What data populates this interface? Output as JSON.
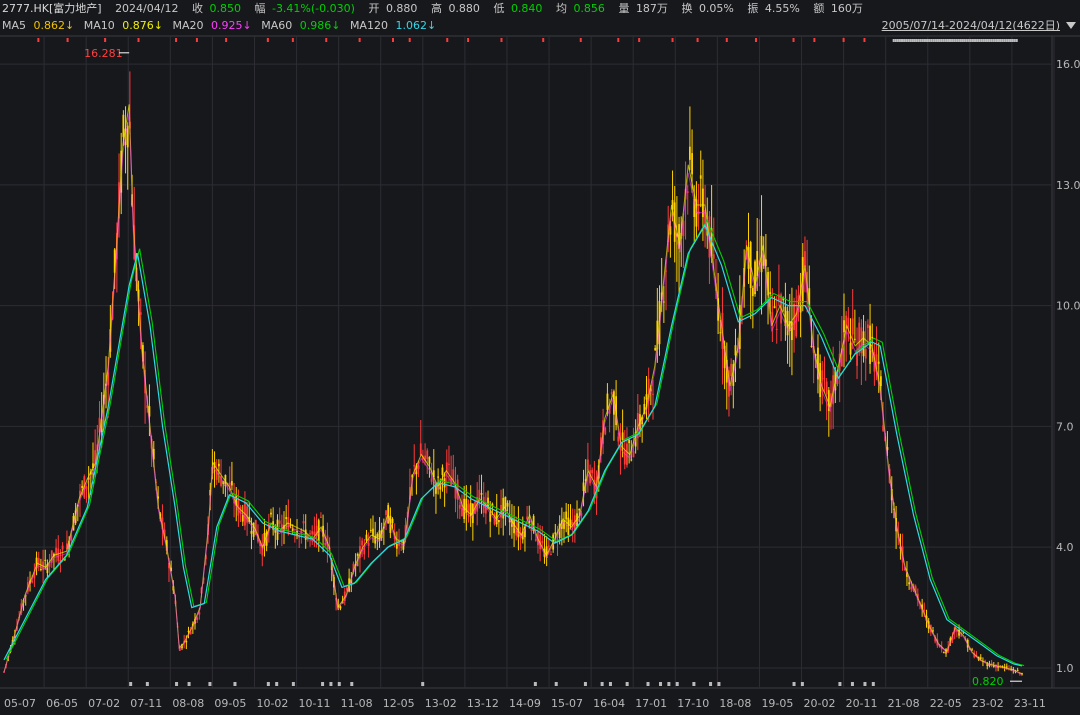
{
  "header": {
    "ticker": "2777.HK[富力地产]",
    "date": "2024/04/12",
    "close_label": "收",
    "close": "0.850",
    "change_label": "幅",
    "change": "-3.41%(-0.030)",
    "open_label": "开",
    "open": "0.880",
    "high_label": "高",
    "high": "0.880",
    "low_label": "低",
    "low": "0.840",
    "avg_label": "均",
    "avg": "0.856",
    "volume_label": "量",
    "volume": "187万",
    "turnover_label": "换",
    "turnover": "0.05%",
    "amplitude_label": "振",
    "amplitude": "4.55%",
    "amount_label": "额",
    "amount": "160万"
  },
  "ma_legend": [
    {
      "label": "MA5",
      "value": "0.862↓",
      "color": "#f0c000"
    },
    {
      "label": "MA10",
      "value": "0.876↓",
      "color": "#f0f000"
    },
    {
      "label": "MA20",
      "value": "0.925↓",
      "color": "#ff3cff"
    },
    {
      "label": "MA60",
      "value": "0.986↓",
      "color": "#00d000"
    },
    {
      "label": "MA120",
      "value": "1.062↓",
      "color": "#30d8e8"
    }
  ],
  "range_label": "2005/07/14-2024/04/12(4622日)",
  "colors": {
    "up": "#ff3a3a",
    "down": "#00e0e0",
    "grid": "#2c2d33",
    "axis": "#b8b8b8"
  },
  "chart_data": {
    "type": "line",
    "ylim": [
      0.8,
      16.5
    ],
    "y_ticks": [
      {
        "value": 16.0,
        "label": "16.0"
      },
      {
        "value": 13.0,
        "label": "13.0"
      },
      {
        "value": 10.0,
        "label": "10.0"
      },
      {
        "value": 7.0,
        "label": "7.0"
      },
      {
        "value": 4.0,
        "label": "4.0"
      },
      {
        "value": 1.0,
        "label": "1.0"
      }
    ],
    "x_ticks": [
      "05-07",
      "06-05",
      "07-02",
      "07-11",
      "08-08",
      "09-05",
      "10-02",
      "10-11",
      "11-08",
      "12-05",
      "13-02",
      "13-12",
      "14-09",
      "15-07",
      "16-04",
      "17-01",
      "17-10",
      "18-08",
      "19-05",
      "20-02",
      "20-11",
      "21-08",
      "22-05",
      "23-02",
      "23-11"
    ],
    "x_tick_index": [
      0,
      1,
      2,
      3,
      4,
      5,
      6,
      7,
      8,
      9,
      10,
      11,
      12,
      13,
      14,
      15,
      16,
      17,
      18,
      19,
      20,
      21,
      22,
      23,
      24
    ],
    "price": [
      [
        0,
        0.9
      ],
      [
        0.3,
        2.0
      ],
      [
        0.5,
        2.8
      ],
      [
        0.8,
        3.6
      ],
      [
        1.0,
        3.5
      ],
      [
        1.2,
        3.8
      ],
      [
        1.5,
        3.9
      ],
      [
        1.8,
        5.2
      ],
      [
        2.0,
        5.7
      ],
      [
        2.2,
        6.1
      ],
      [
        2.5,
        8.5
      ],
      [
        2.7,
        11.5
      ],
      [
        2.85,
        14.0
      ],
      [
        3.0,
        15.0
      ],
      [
        3.1,
        12.0
      ],
      [
        3.3,
        9.0
      ],
      [
        3.5,
        7.0
      ],
      [
        3.7,
        5.0
      ],
      [
        3.9,
        4.0
      ],
      [
        4.1,
        2.8
      ],
      [
        4.2,
        1.5
      ],
      [
        4.3,
        1.6
      ],
      [
        4.5,
        2.0
      ],
      [
        4.7,
        2.5
      ],
      [
        4.9,
        4.5
      ],
      [
        5.0,
        6.1
      ],
      [
        5.2,
        5.8
      ],
      [
        5.4,
        5.5
      ],
      [
        5.6,
        5.0
      ],
      [
        5.8,
        4.8
      ],
      [
        6.0,
        4.5
      ],
      [
        6.2,
        4.0
      ],
      [
        6.4,
        4.6
      ],
      [
        6.6,
        4.4
      ],
      [
        6.8,
        4.6
      ],
      [
        7.0,
        4.5
      ],
      [
        7.2,
        4.4
      ],
      [
        7.4,
        4.2
      ],
      [
        7.6,
        4.5
      ],
      [
        7.8,
        4.0
      ],
      [
        8.0,
        2.5
      ],
      [
        8.2,
        2.8
      ],
      [
        8.4,
        3.5
      ],
      [
        8.6,
        4.0
      ],
      [
        8.8,
        4.3
      ],
      [
        9.0,
        4.2
      ],
      [
        9.2,
        4.8
      ],
      [
        9.4,
        4.2
      ],
      [
        9.6,
        4.1
      ],
      [
        9.8,
        5.8
      ],
      [
        10.0,
        6.3
      ],
      [
        10.2,
        6.0
      ],
      [
        10.4,
        5.5
      ],
      [
        10.6,
        5.9
      ],
      [
        10.8,
        5.6
      ],
      [
        11.0,
        5.0
      ],
      [
        11.2,
        4.8
      ],
      [
        11.4,
        5.2
      ],
      [
        11.6,
        5.0
      ],
      [
        11.8,
        4.7
      ],
      [
        12.0,
        5.0
      ],
      [
        12.2,
        4.6
      ],
      [
        12.4,
        4.3
      ],
      [
        12.6,
        4.8
      ],
      [
        12.8,
        4.2
      ],
      [
        13.0,
        3.8
      ],
      [
        13.2,
        4.2
      ],
      [
        13.4,
        4.7
      ],
      [
        13.6,
        4.5
      ],
      [
        13.8,
        4.8
      ],
      [
        14.0,
        5.9
      ],
      [
        14.2,
        5.5
      ],
      [
        14.4,
        7.2
      ],
      [
        14.6,
        7.8
      ],
      [
        14.8,
        6.5
      ],
      [
        15.0,
        6.3
      ],
      [
        15.2,
        7.0
      ],
      [
        15.4,
        7.5
      ],
      [
        15.6,
        8.5
      ],
      [
        15.8,
        10.5
      ],
      [
        16.0,
        12.5
      ],
      [
        16.2,
        11.5
      ],
      [
        16.4,
        13.5
      ],
      [
        16.6,
        12.5
      ],
      [
        16.8,
        12.5
      ],
      [
        17.0,
        11.0
      ],
      [
        17.2,
        9.5
      ],
      [
        17.4,
        8.0
      ],
      [
        17.6,
        9.0
      ],
      [
        17.8,
        11.5
      ],
      [
        18.0,
        10.5
      ],
      [
        18.2,
        11.5
      ],
      [
        18.4,
        9.5
      ],
      [
        18.6,
        10.0
      ],
      [
        18.8,
        9.5
      ],
      [
        19.0,
        9.8
      ],
      [
        19.2,
        11.0
      ],
      [
        19.4,
        9.0
      ],
      [
        19.6,
        8.0
      ],
      [
        19.8,
        7.5
      ],
      [
        20.0,
        8.5
      ],
      [
        20.2,
        9.5
      ],
      [
        20.4,
        9.0
      ],
      [
        20.6,
        9.2
      ],
      [
        20.8,
        9.0
      ],
      [
        21.0,
        8.0
      ],
      [
        21.2,
        6.0
      ],
      [
        21.4,
        4.5
      ],
      [
        21.6,
        3.5
      ],
      [
        21.8,
        3.0
      ],
      [
        22.0,
        2.5
      ],
      [
        22.2,
        2.0
      ],
      [
        22.4,
        1.6
      ],
      [
        22.6,
        1.4
      ],
      [
        22.8,
        2.0
      ],
      [
        23.0,
        1.8
      ],
      [
        23.2,
        1.4
      ],
      [
        23.4,
        1.2
      ],
      [
        23.6,
        1.1
      ],
      [
        23.8,
        1.05
      ],
      [
        24.0,
        1.0
      ],
      [
        24.2,
        0.95
      ],
      [
        24.4,
        0.85
      ]
    ],
    "ma_long": [
      [
        0,
        1.2
      ],
      [
        0.5,
        2.2
      ],
      [
        1.0,
        3.2
      ],
      [
        1.5,
        3.8
      ],
      [
        2.0,
        5.0
      ],
      [
        2.5,
        7.5
      ],
      [
        3.0,
        10.5
      ],
      [
        3.2,
        11.3
      ],
      [
        3.5,
        9.5
      ],
      [
        3.8,
        7.0
      ],
      [
        4.1,
        5.0
      ],
      [
        4.3,
        3.5
      ],
      [
        4.5,
        2.5
      ],
      [
        4.8,
        2.6
      ],
      [
        5.1,
        4.5
      ],
      [
        5.4,
        5.3
      ],
      [
        5.8,
        5.1
      ],
      [
        6.2,
        4.6
      ],
      [
        6.6,
        4.4
      ],
      [
        7.0,
        4.3
      ],
      [
        7.4,
        4.2
      ],
      [
        7.8,
        3.8
      ],
      [
        8.1,
        3.0
      ],
      [
        8.4,
        3.1
      ],
      [
        8.8,
        3.6
      ],
      [
        9.2,
        4.0
      ],
      [
        9.6,
        4.2
      ],
      [
        10.0,
        5.2
      ],
      [
        10.4,
        5.6
      ],
      [
        10.8,
        5.5
      ],
      [
        11.2,
        5.2
      ],
      [
        11.6,
        5.0
      ],
      [
        12.0,
        4.8
      ],
      [
        12.4,
        4.6
      ],
      [
        12.8,
        4.4
      ],
      [
        13.2,
        4.1
      ],
      [
        13.6,
        4.3
      ],
      [
        14.0,
        4.9
      ],
      [
        14.4,
        5.9
      ],
      [
        14.8,
        6.6
      ],
      [
        15.2,
        6.8
      ],
      [
        15.6,
        7.5
      ],
      [
        16.0,
        9.5
      ],
      [
        16.4,
        11.3
      ],
      [
        16.8,
        12.0
      ],
      [
        17.2,
        11.0
      ],
      [
        17.6,
        9.6
      ],
      [
        18.0,
        9.8
      ],
      [
        18.4,
        10.2
      ],
      [
        18.8,
        10.0
      ],
      [
        19.2,
        10.0
      ],
      [
        19.6,
        9.2
      ],
      [
        20.0,
        8.2
      ],
      [
        20.4,
        8.8
      ],
      [
        20.8,
        9.1
      ],
      [
        21.0,
        9.0
      ],
      [
        21.4,
        6.8
      ],
      [
        21.8,
        4.8
      ],
      [
        22.2,
        3.2
      ],
      [
        22.6,
        2.2
      ],
      [
        23.0,
        1.9
      ],
      [
        23.4,
        1.6
      ],
      [
        23.8,
        1.3
      ],
      [
        24.2,
        1.1
      ],
      [
        24.4,
        1.05
      ]
    ],
    "max_label": "16.281",
    "max_point": [
      3.0,
      16.281
    ],
    "min_label": "0.820",
    "min_point": [
      24.4,
      0.82
    ]
  }
}
